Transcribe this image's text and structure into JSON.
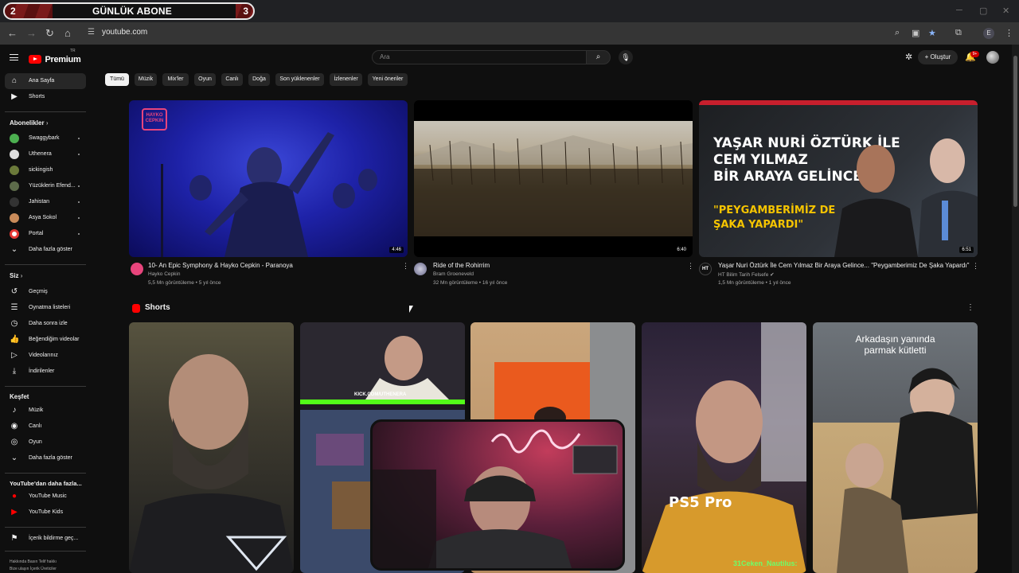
{
  "overlay": {
    "sub_label": "GÜNLÜK ABONE",
    "sub_current": "2",
    "sub_goal": "3"
  },
  "browser": {
    "url": "youtube.com",
    "profile_letter": "E"
  },
  "header": {
    "logo_text": "Premium",
    "logo_tr": "TR",
    "search_placeholder": "Ara",
    "create_label": "+ Oluştur",
    "notif_count": "9+"
  },
  "sidebar": {
    "main": [
      {
        "label": "Ana Sayfa",
        "icon": "home-icon"
      },
      {
        "label": "Shorts",
        "icon": "shorts-icon"
      }
    ],
    "subs_heading": "Abonelikler",
    "subs": [
      {
        "label": "Swaggybark",
        "color": "#4caf50"
      },
      {
        "label": "Uthenera",
        "color": "#ffffff"
      },
      {
        "label": "sickingish",
        "color": "#6b7a3a"
      },
      {
        "label": "Yüzüklerin Efend...",
        "color": "#5d6b4a"
      },
      {
        "label": "Jahistan",
        "color": "#333333"
      },
      {
        "label": "Asya Sokol",
        "color": "#c98b5a"
      },
      {
        "label": "Portal",
        "color": "#e53935"
      }
    ],
    "subs_more": "Daha fazla göster",
    "you_heading": "Siz",
    "you": [
      {
        "label": "Geçmiş",
        "icon": "history-icon"
      },
      {
        "label": "Oynatma listeleri",
        "icon": "playlists-icon"
      },
      {
        "label": "Daha sonra izle",
        "icon": "watch-later-icon"
      },
      {
        "label": "Beğendiğim videolar",
        "icon": "like-icon"
      },
      {
        "label": "Videolarınız",
        "icon": "your-videos-icon"
      },
      {
        "label": "İndirilenler",
        "icon": "download-icon"
      }
    ],
    "explore_heading": "Keşfet",
    "explore": [
      {
        "label": "Müzik",
        "icon": "music-icon"
      },
      {
        "label": "Canlı",
        "icon": "live-icon"
      },
      {
        "label": "Oyun",
        "icon": "gaming-icon"
      },
      {
        "label": "Daha fazla göster",
        "icon": "chevron-down-icon"
      }
    ],
    "more_heading": "YouTube'dan daha fazla...",
    "more": [
      {
        "label": "YouTube Music",
        "icon": "yt-music-icon"
      },
      {
        "label": "YouTube Kids",
        "icon": "yt-kids-icon"
      }
    ],
    "report": "İçerik bildirme geç...",
    "footer1": "Hakkında  Basın  Telif hakkı",
    "footer2": "Bize ulaşın  İçerik Üreticiler"
  },
  "chips": [
    "Tümü",
    "Müzik",
    "Mix'ler",
    "Oyun",
    "Canlı",
    "Doğa",
    "Son yüklenenler",
    "İzlenenler",
    "Yeni öneriler"
  ],
  "videos": [
    {
      "title": "10- An Epic Symphony & Hayko Cepkin - Paranoya",
      "channel": "Hayko Cepkin",
      "stats": "5,5 Mn görüntüleme • 5 yıl önce",
      "duration": "4:46",
      "thumb_text": "HAYKO CEPKIN"
    },
    {
      "title": "Ride of the Rohirrim",
      "channel": "Bram Groeneveld",
      "stats": "32 Mn görüntüleme • 16 yıl önce",
      "duration": "6:40"
    },
    {
      "title": "Yaşar Nuri Öztürk İle Cem Yılmaz Bir Araya Gelince... \"Peygamberimiz De Şaka Yapardı\"",
      "channel": "HT Bilim Tarih Felsefe",
      "stats": "1,5 Mn görüntüleme • 1 yıl önce",
      "duration": "6:51",
      "thumb_line1": "YAŞAR NURİ ÖZTÜRK İLE",
      "thumb_line2": "CEM YILMAZ",
      "thumb_line3": "BİR ARAYA GELİNCE...",
      "thumb_quote1": "\"PEYGAMBERİMİZ DE",
      "thumb_quote2": "ŞAKA YAPARDI\"",
      "avatar_text": "HT"
    }
  ],
  "shorts": {
    "title": "Shorts",
    "items": [
      {
        "caption": ""
      },
      {
        "caption": "KICK.COM/UTHENERA"
      },
      {
        "caption": ""
      },
      {
        "caption": "PS5 Pro"
      },
      {
        "caption_1": "Arkadaşın yanında",
        "caption_2": "parmak kütletti"
      }
    ]
  },
  "chat": "31Ceken_Nautilus:"
}
